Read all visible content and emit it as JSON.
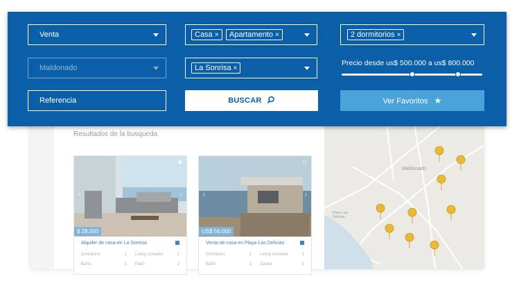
{
  "filters": {
    "operation": {
      "value": "Venta"
    },
    "property_types": {
      "chips": [
        "Casa",
        "Apartamento"
      ]
    },
    "bedrooms": {
      "chips": [
        "2 dormitorios"
      ]
    },
    "department": {
      "placeholder": "Maldonado"
    },
    "locality": {
      "chips": [
        "La Sonrisa"
      ]
    },
    "price": {
      "label": "Precio desde us$ 500.000 a us$ 800.000",
      "min_fraction": 0.5,
      "max_fraction": 0.83
    },
    "reference": {
      "placeholder": "Referencia"
    },
    "search_button": "BUSCAR",
    "favorites_button": "Ver Favoritos"
  },
  "results": {
    "title": "Resultados de la busqueda",
    "cards": [
      {
        "price": "$ 28.000",
        "title": "Alquiler de casa en La Sonrisa",
        "specs": [
          {
            "label": "Dormitorio",
            "value": "2"
          },
          {
            "label": "Living comedor",
            "value": "2"
          },
          {
            "label": "Baño",
            "value": "1"
          },
          {
            "label": "Patio",
            "value": "2"
          }
        ]
      },
      {
        "price": "US$ 56.000",
        "title": "Venta de casa en Playa Las Delicias",
        "specs": [
          {
            "label": "Dormitorio",
            "value": "2"
          },
          {
            "label": "Living comedor",
            "value": "1"
          },
          {
            "label": "Baño",
            "value": "1"
          },
          {
            "label": "Sauna",
            "value": "1"
          }
        ]
      }
    ]
  },
  "map": {
    "city_label": "Maldonado",
    "beach_label": "Playa Las Delicias"
  },
  "colors": {
    "panel": "#0b5fa8",
    "favorites": "#4aa3d9",
    "pin": "#e8b839"
  },
  "icons": {
    "search": "search-icon",
    "star": "star-icon",
    "caret": "caret-down-icon",
    "pin": "map-pin-icon"
  }
}
